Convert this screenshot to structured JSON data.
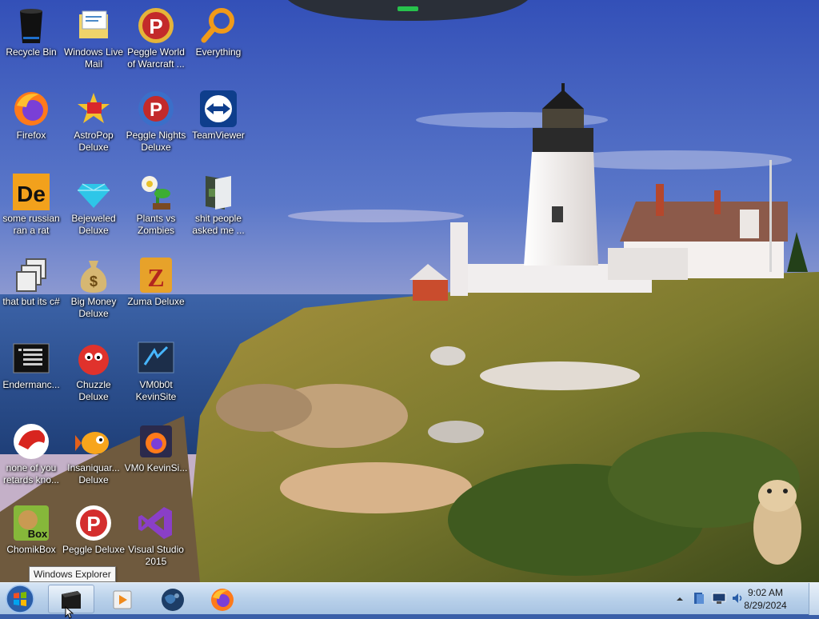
{
  "desktop": {
    "icons": [
      {
        "label": "Recycle Bin",
        "icon": "recycle-bin-icon"
      },
      {
        "label": "Windows Live Mail",
        "icon": "mail-icon"
      },
      {
        "label": "Peggle World of Warcraft ...",
        "icon": "peggle-icon"
      },
      {
        "label": "Everything",
        "icon": "search-icon"
      },
      {
        "label": "Firefox",
        "icon": "firefox-icon"
      },
      {
        "label": "AstroPop Deluxe",
        "icon": "astropop-icon"
      },
      {
        "label": "Peggle Nights Deluxe",
        "icon": "peggle-nights-icon"
      },
      {
        "label": "TeamViewer",
        "icon": "teamviewer-icon"
      },
      {
        "label": "some russian ran a rat",
        "icon": "de-app-icon"
      },
      {
        "label": "Bejeweled Deluxe",
        "icon": "gem-icon"
      },
      {
        "label": "Plants vs Zombies",
        "icon": "flower-icon"
      },
      {
        "label": "shit people asked me ...",
        "icon": "folder-icon"
      },
      {
        "label": "that but its c#",
        "icon": "windows-stack-icon"
      },
      {
        "label": "Big Money Deluxe",
        "icon": "money-bag-icon"
      },
      {
        "label": "Zuma Deluxe",
        "icon": "zuma-icon"
      },
      {
        "label": "Endermanc...",
        "icon": "console-icon"
      },
      {
        "label": "Chuzzle Deluxe",
        "icon": "chuzzle-icon"
      },
      {
        "label": "VM0b0t KevinSite",
        "icon": "vm-icon"
      },
      {
        "label": "none of you retards kno...",
        "icon": "red-creature-icon"
      },
      {
        "label": "Insaniquar... Deluxe",
        "icon": "fish-icon"
      },
      {
        "label": "VM0 KevinSi...",
        "icon": "firefox-dev-icon"
      },
      {
        "label": "ChomikBox",
        "icon": "chomikbox-icon"
      },
      {
        "label": "Peggle Deluxe",
        "icon": "peggle-deluxe-icon"
      },
      {
        "label": "Visual Studio 2015",
        "icon": "visual-studio-icon"
      }
    ],
    "tooltip": "Windows Explorer"
  },
  "taskbar": {
    "items": [
      {
        "name": "start-orb",
        "icon": "windows-logo-icon"
      },
      {
        "name": "windows-explorer",
        "icon": "explorer-icon"
      },
      {
        "name": "media-player",
        "icon": "media-player-icon"
      },
      {
        "name": "globe-app",
        "icon": "globe-icon"
      },
      {
        "name": "firefox",
        "icon": "firefox-icon"
      }
    ],
    "clock": {
      "time": "9:02 AM",
      "date": "8/29/2024"
    }
  },
  "colors": {
    "taskbar_top": "#d6e5f5",
    "taskbar_bottom": "#a7c3e2",
    "sky": "#3a5fa8",
    "accent_green": "#27c24c"
  }
}
